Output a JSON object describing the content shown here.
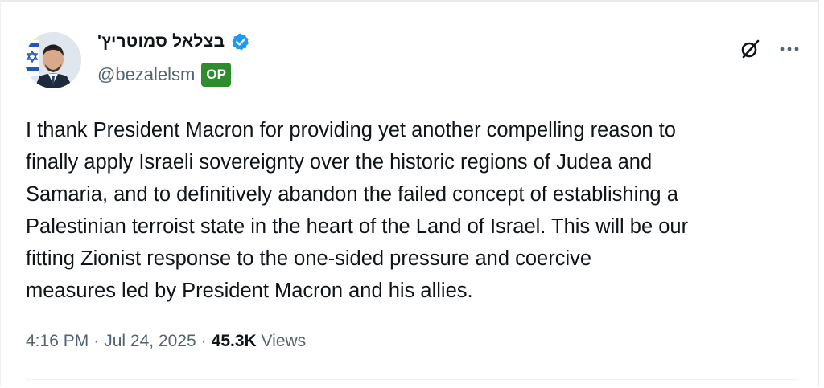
{
  "author": {
    "display_name": "בצלאל סמוטריץ'",
    "handle": "@bezalelsm",
    "op_badge": "OP",
    "verified_icon": "verified-badge-icon",
    "brand_blue": "#1d9bf0",
    "badge_green": "#2e8b2e"
  },
  "tweet": {
    "text": "I thank President Macron for providing yet another compelling reason to\nfinally apply Israeli sovereignty over the historic regions of Judea and\nSamaria, and to definitively abandon the failed concept of establishing a\nPalestinian terroist state in the heart of the Land of Israel. This will be our\nfitting Zionist response to the one-sided pressure and coercive\nmeasures led by President Macron and his allies."
  },
  "meta": {
    "time": "4:16 PM",
    "separator": "·",
    "date": "Jul 24, 2025",
    "views_count": "45.3K",
    "views_label": "Views"
  },
  "actions": {
    "grok_icon": "grok-icon",
    "more_icon": "more-options-icon"
  }
}
